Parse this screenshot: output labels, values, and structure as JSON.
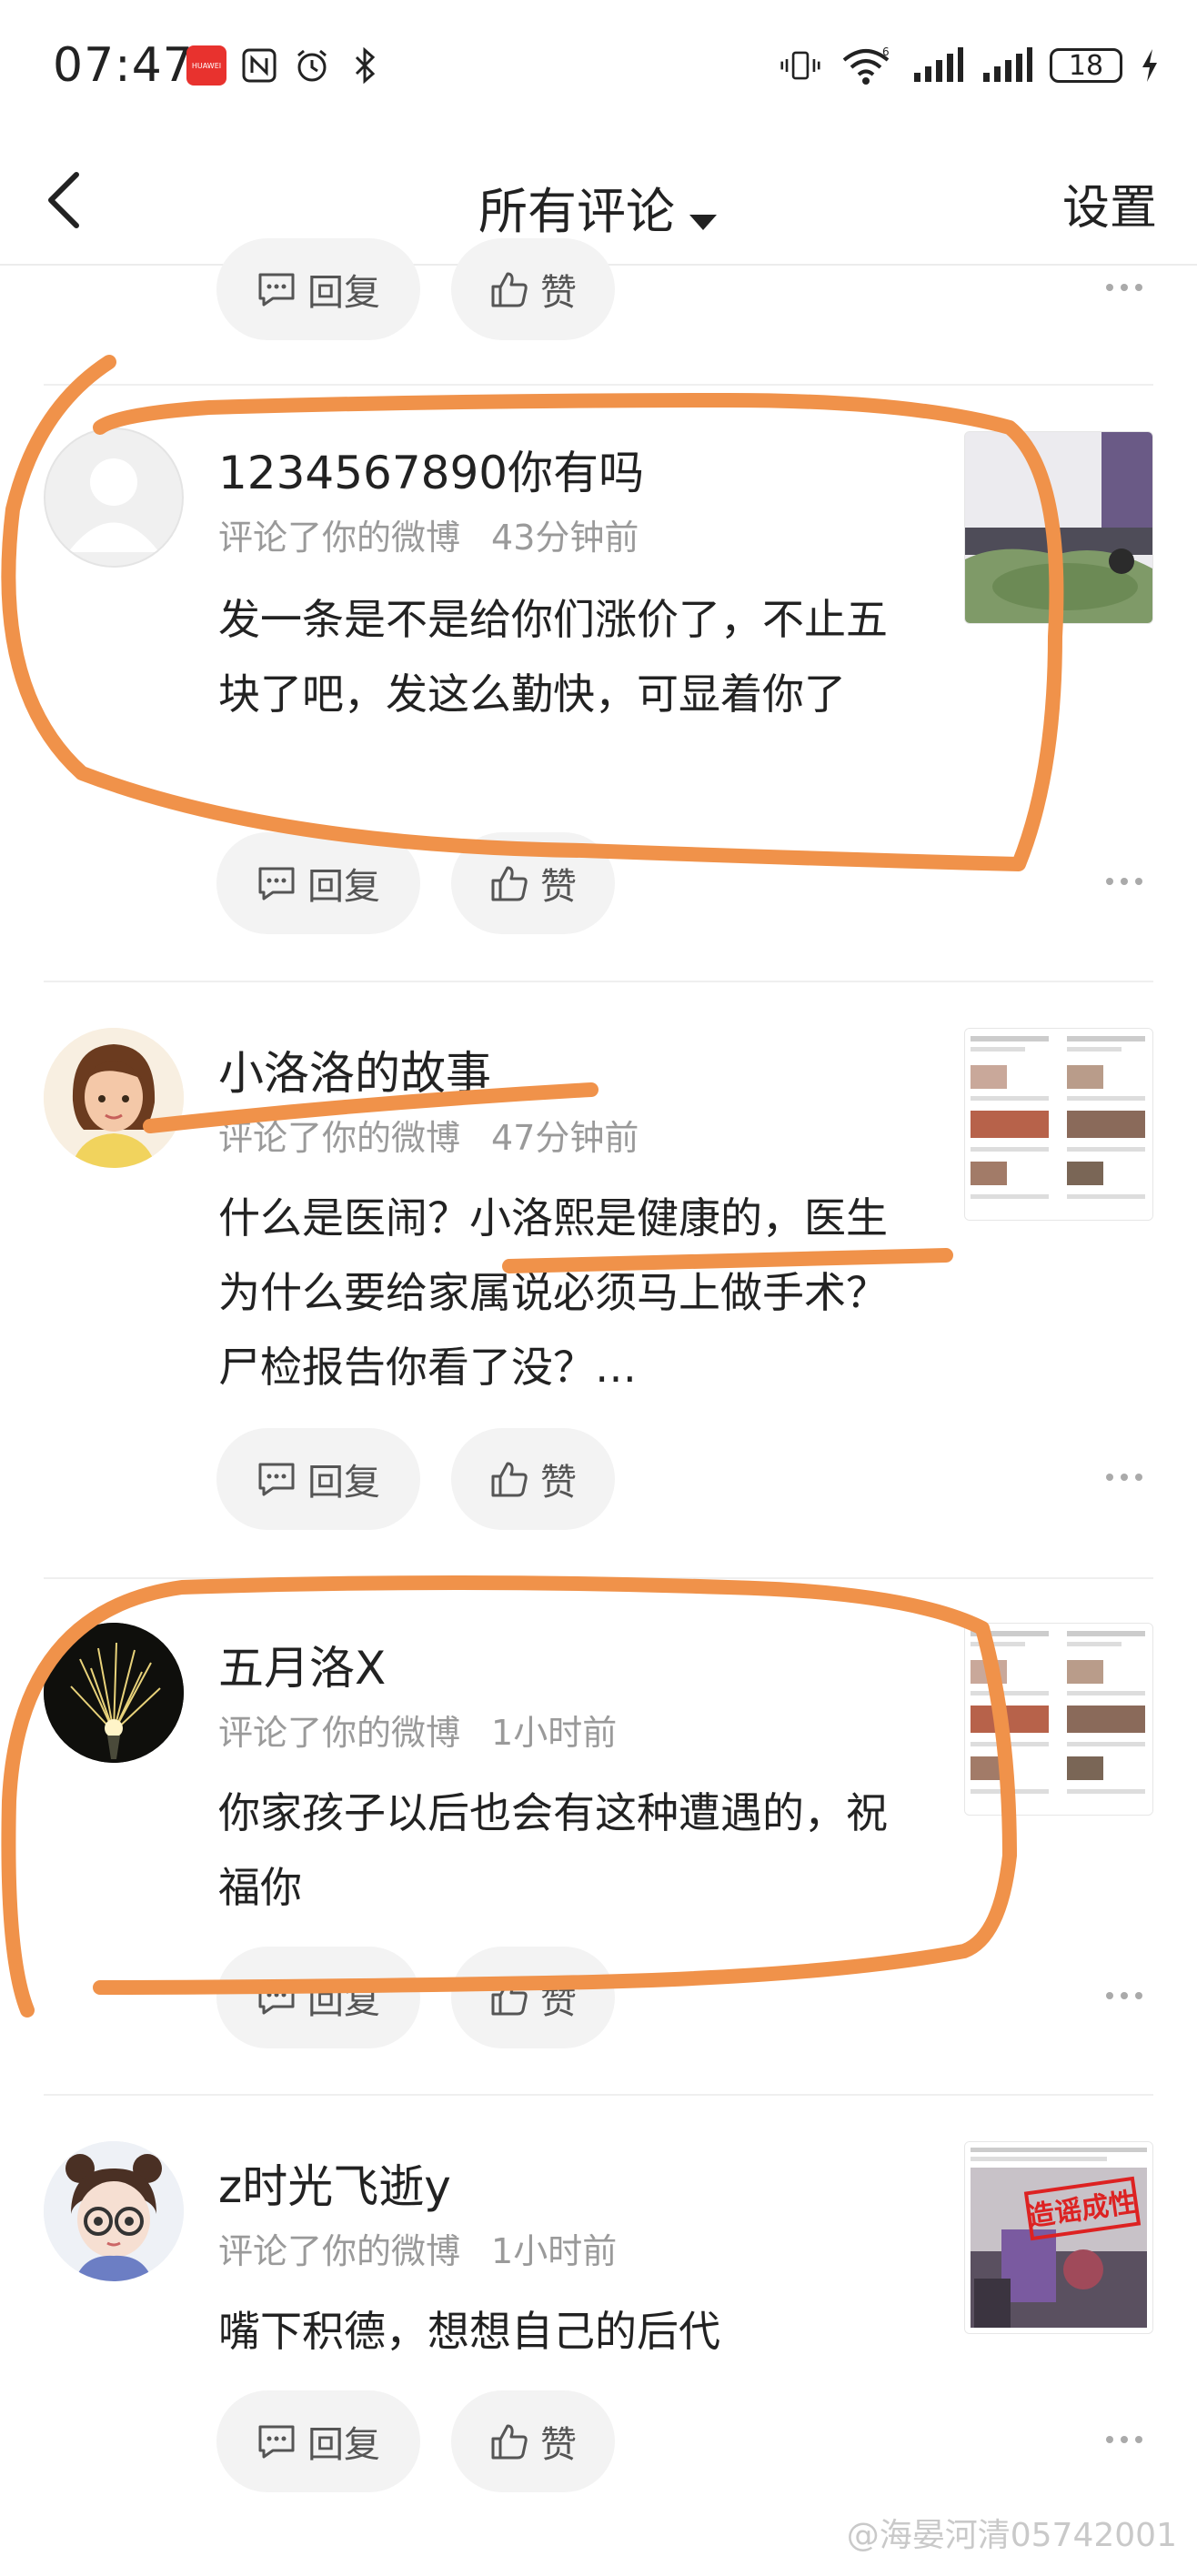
{
  "status_bar": {
    "time": "07:47",
    "huawei_label": "HUAWEI",
    "battery": "18",
    "signal_label": "6"
  },
  "nav": {
    "title": "所有评论",
    "settings": "设置"
  },
  "actions": {
    "reply": "回复",
    "like": "赞"
  },
  "comments": [
    {
      "name": "1234567890你有吗",
      "action": "评论了你的微博",
      "time": "43分钟前",
      "text": "发一条是不是给你们涨价了，不止五块了吧，发这么勤快，可显着你了"
    },
    {
      "name": "小洛洛的故事",
      "action": "评论了你的微博",
      "time": "47分钟前",
      "text": "什么是医闹？小洛熙是健康的，医生为什么要给家属说必须马上做手术？尸检报告你看了没？…"
    },
    {
      "name": "五月洛X",
      "action": "评论了你的微博",
      "time": "1小时前",
      "text": "你家孩子以后也会有这种遭遇的，祝福你"
    },
    {
      "name": "z时光飞逝y",
      "action": "评论了你的微博",
      "time": "1小时前",
      "text": "嘴下积德，想想自己的后代"
    }
  ],
  "thumb_stamp": "造谣成性",
  "watermark": "@海晏河清05742001",
  "colors": {
    "annotation": "#f0924a",
    "muted": "#9a9a9a",
    "pill_bg": "#f3f3f3"
  }
}
